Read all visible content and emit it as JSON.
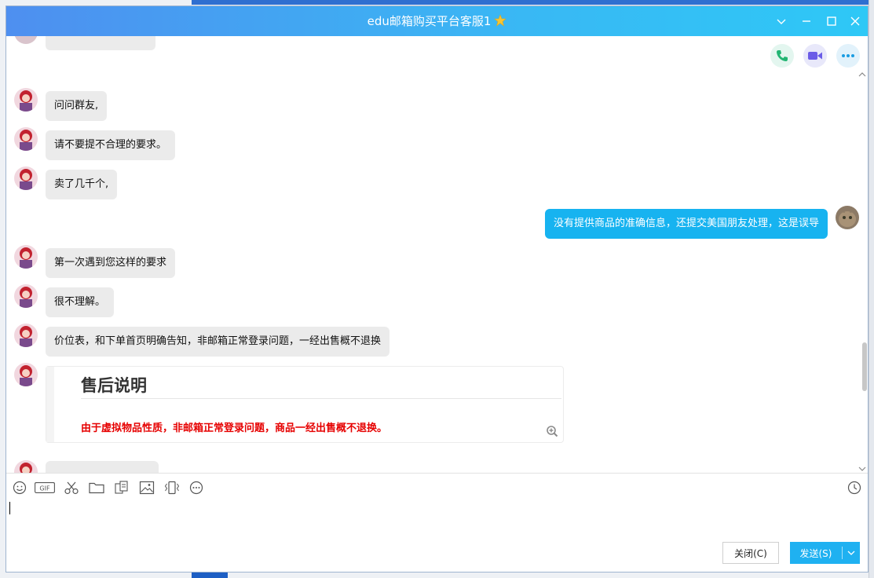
{
  "window": {
    "title": "edu邮箱购买平台客服1"
  },
  "chat": {
    "messages": [
      {
        "side": "in",
        "text": "问问群友,"
      },
      {
        "side": "in",
        "text": "请不要提不合理的要求。"
      },
      {
        "side": "in",
        "text": "卖了几千个,"
      },
      {
        "side": "out",
        "text": "没有提供商品的准确信息，还提交美国朋友处理，这是误导"
      },
      {
        "side": "in",
        "text": "第一次遇到您这样的要求"
      },
      {
        "side": "in",
        "text": "很不理解。"
      },
      {
        "side": "in",
        "text": "价位表，和下单首页明确告知，非邮箱正常登录问题，一经出售概不退换"
      }
    ],
    "card": {
      "title": "售后说明",
      "body": "由于虚拟物品性质，非邮箱正常登录问题，商品一经出售概不退换。"
    }
  },
  "toolbar": {
    "icons": [
      "emoji-icon",
      "gif-icon",
      "scissors-icon",
      "folder-icon",
      "doc-icon",
      "image-icon",
      "shake-icon",
      "more-icon"
    ],
    "gif_label": "GIF"
  },
  "buttons": {
    "close": "关闭(C)",
    "send": "发送(S)"
  },
  "colors": {
    "accent": "#1fb1f1",
    "incoming_bubble": "#ebebeb",
    "notice_red": "#e60000"
  }
}
